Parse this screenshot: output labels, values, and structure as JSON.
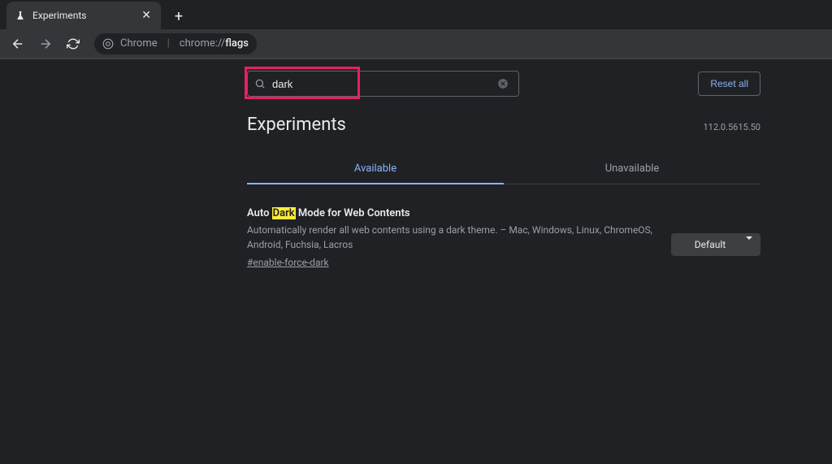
{
  "tab": {
    "title": "Experiments"
  },
  "address": {
    "scheme": "Chrome",
    "path_prefix": "chrome://",
    "path_bold": "flags"
  },
  "search": {
    "value": "dark"
  },
  "reset_label": "Reset all",
  "heading": "Experiments",
  "version": "112.0.5615.50",
  "tabs": {
    "available": "Available",
    "unavailable": "Unavailable"
  },
  "flag": {
    "title_pre": "Auto ",
    "title_highlight": "Dark",
    "title_post": " Mode for Web Contents",
    "description": "Automatically render all web contents using a dark theme. – Mac, Windows, Linux, ChromeOS, Android, Fuchsia, Lacros",
    "id": "#enable-force-dark",
    "select_value": "Default"
  }
}
